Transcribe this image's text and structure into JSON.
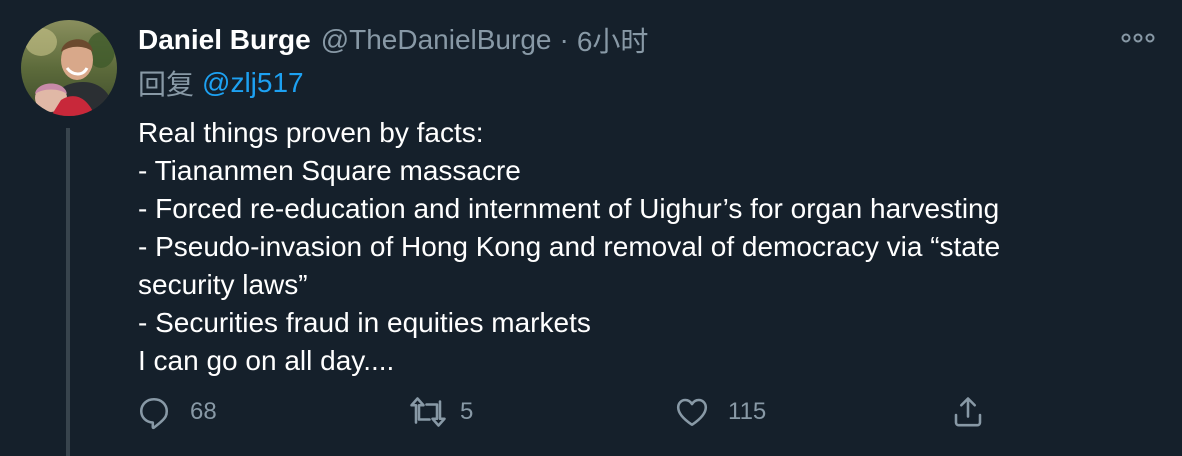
{
  "tweet": {
    "author": {
      "display_name": "Daniel Burge",
      "handle": "@TheDanielBurge",
      "separator": "·",
      "time": "6小时"
    },
    "reply": {
      "prefix": "回复",
      "handle": "@zlj517"
    },
    "body_lines": [
      "Real things proven by facts:",
      "- Tiananmen Square massacre",
      "- Forced re-education and internment of Uighur’s for organ harvesting",
      "- Pseudo-invasion of Hong Kong and removal of democracy via “state",
      "security laws”",
      "- Securities fraud in equities markets",
      "I can go on all day...."
    ],
    "actions": {
      "reply_count": "68",
      "retweet_count": "5",
      "like_count": "115"
    }
  },
  "icons": {
    "reply": "reply-icon",
    "retweet": "retweet-icon",
    "like": "heart-icon",
    "share": "share-icon",
    "more": "more-icon"
  },
  "colors": {
    "background": "#15202b",
    "secondary_text": "#8899a6",
    "link": "#1da1f2",
    "thread_line": "#38444d"
  }
}
